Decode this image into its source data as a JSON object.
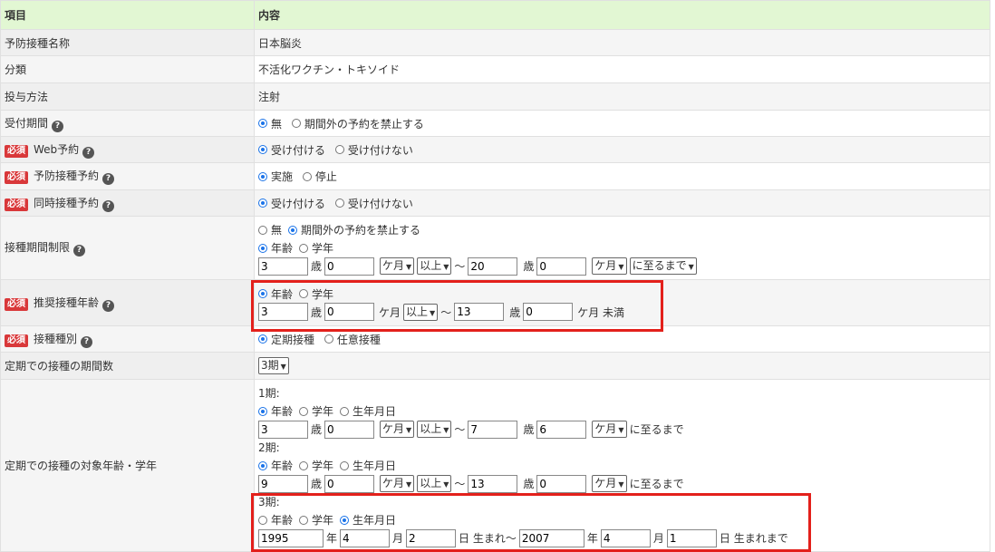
{
  "header": {
    "col1": "項目",
    "col2": "内容"
  },
  "badge": "必須",
  "rows": {
    "name": {
      "label": "予防接種名称",
      "value": "日本脳炎"
    },
    "category": {
      "label": "分類",
      "value": "不活化ワクチン・トキソイド"
    },
    "method": {
      "label": "投与方法",
      "value": "注射"
    },
    "reception": {
      "label": "受付期間",
      "opt1": "無",
      "opt2": "期間外の予約を禁止する"
    },
    "web": {
      "label": "Web予約",
      "opt1": "受け付ける",
      "opt2": "受け付けない"
    },
    "vaccine_reservation": {
      "label": "予防接種予約",
      "opt1": "実施",
      "opt2": "停止"
    },
    "simultaneous": {
      "label": "同時接種予約",
      "opt1": "受け付ける",
      "opt2": "受け付けない"
    },
    "period_limit": {
      "label": "接種期間制限",
      "opt1": "無",
      "opt2": "期間外の予約を禁止する",
      "opt3": "年齢",
      "opt4": "学年",
      "from_years": "3",
      "from_months": "0",
      "from_unit": "ケ月",
      "from_cond": "以上",
      "to_years": "20",
      "to_months": "0",
      "to_unit": "ケ月",
      "to_cond": "に至るまで"
    },
    "recommended": {
      "label": "推奨接種年齢",
      "opt1": "年齢",
      "opt2": "学年",
      "from_years": "3",
      "from_months": "0",
      "from_cond": "以上",
      "to_years": "13",
      "to_months": "0",
      "suffix": "ケ月 未満"
    },
    "type": {
      "label": "接種種別",
      "opt1": "定期接種",
      "opt2": "任意接種"
    },
    "period_count": {
      "label": "定期での接種の期間数",
      "value": "3期"
    },
    "target": {
      "label": "定期での接種の対象年齢・学年",
      "p1": {
        "title": "1期:",
        "o1": "年齢",
        "o2": "学年",
        "o3": "生年月日",
        "fy": "3",
        "fm": "0",
        "fu": "ケ月",
        "fc": "以上",
        "ty": "7",
        "tm": "6",
        "tu": "ケ月",
        "end": "に至るまで"
      },
      "p2": {
        "title": "2期:",
        "o1": "年齢",
        "o2": "学年",
        "o3": "生年月日",
        "fy": "9",
        "fm": "0",
        "fu": "ケ月",
        "fc": "以上",
        "ty": "13",
        "tm": "0",
        "tu": "ケ月",
        "end": "に至るまで"
      },
      "p3": {
        "title": "3期:",
        "o1": "年齢",
        "o2": "学年",
        "o3": "生年月日",
        "fy": "1995",
        "fm": "4",
        "fd": "2",
        "mid": "日 生まれ〜",
        "ty": "2007",
        "tm": "4",
        "td": "1",
        "end": "日 生まれまで"
      }
    }
  },
  "units": {
    "sai": "歳",
    "month": "ケ月",
    "tilde": "〜",
    "year": "年",
    "mon": "月"
  }
}
